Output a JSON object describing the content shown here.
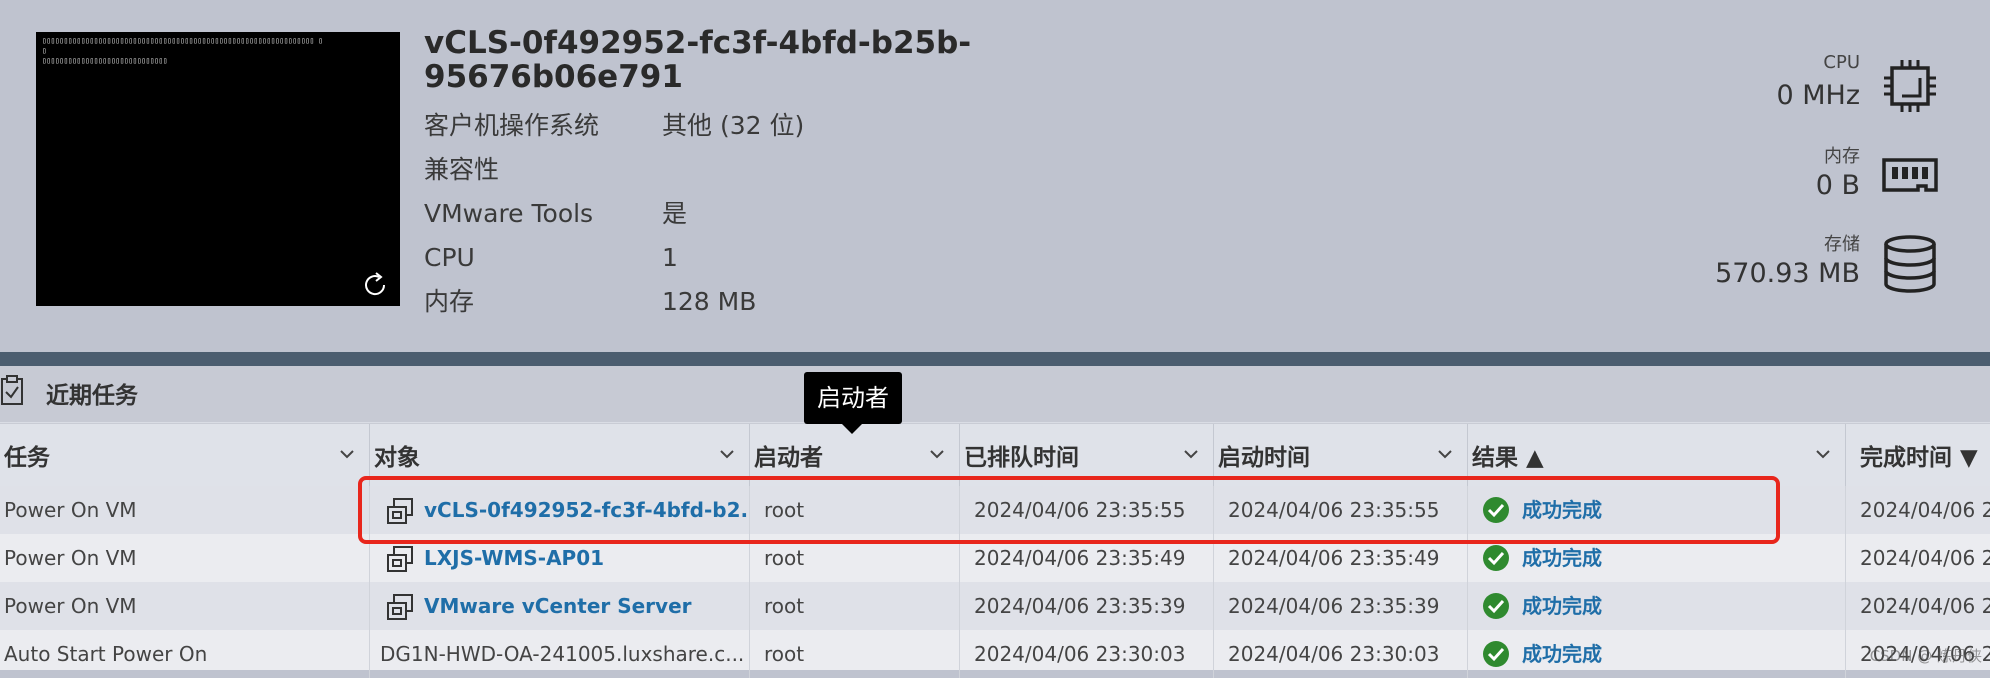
{
  "vm": {
    "title": "vCLS-0f492952-fc3f-4bfd-b25b-95676b06e791",
    "console_lines": [
      "▯▯▯▯▯▯▯▯▯▯▯▯▯▯▯▯▯▯▯▯▯▯▯▯▯▯▯▯▯▯▯▯▯▯▯▯▯▯▯▯▯▯▯▯▯▯▯▯▯▯▯▯▯▯▯▯▯▯▯▯▯▯▯ ▯",
      "▯",
      "▯▯▯▯▯▯▯▯▯▯▯▯▯▯▯▯▯▯▯▯▯▯▯▯▯▯▯▯▯"
    ],
    "properties": [
      {
        "label": "客户机操作系统",
        "value": "其他 (32 位)"
      },
      {
        "label": "兼容性",
        "value": ""
      },
      {
        "label": "VMware Tools",
        "value": "是"
      },
      {
        "label": "CPU",
        "value": "1"
      },
      {
        "label": "内存",
        "value": "128 MB"
      }
    ]
  },
  "resources": {
    "cpu": {
      "label": "CPU",
      "value": "0 MHz",
      "icon": "cpu-icon"
    },
    "memory": {
      "label": "内存",
      "value": "0 B",
      "icon": "memory-icon"
    },
    "storage": {
      "label": "存储",
      "value": "570.93 MB",
      "icon": "storage-icon"
    }
  },
  "recent_tasks": {
    "title": "近期任务",
    "tooltip": "启动者",
    "columns": [
      {
        "label": "任务"
      },
      {
        "label": "对象"
      },
      {
        "label": "启动者"
      },
      {
        "label": "已排队时间"
      },
      {
        "label": "启动时间"
      },
      {
        "label": "结果 ▲"
      },
      {
        "label": "完成时间 ▼"
      }
    ],
    "rows": [
      {
        "task": "Power On VM",
        "object": "vCLS-0f492952-fc3f-4bfd-b2...",
        "object_is_link": true,
        "initiator": "root",
        "queued": "2024/04/06 23:35:55",
        "started": "2024/04/06 23:35:55",
        "result": "成功完成",
        "completed": "2024/04/06 2"
      },
      {
        "task": "Power On VM",
        "object": "LXJS-WMS-AP01",
        "object_is_link": true,
        "initiator": "root",
        "queued": "2024/04/06 23:35:49",
        "started": "2024/04/06 23:35:49",
        "result": "成功完成",
        "completed": "2024/04/06 2"
      },
      {
        "task": "Power On VM",
        "object": "VMware vCenter Server",
        "object_is_link": true,
        "initiator": "root",
        "queued": "2024/04/06 23:35:39",
        "started": "2024/04/06 23:35:39",
        "result": "成功完成",
        "completed": "2024/04/06 2"
      },
      {
        "task": "Auto Start Power On",
        "object": "DG1N-HWD-OA-241005.luxshare.c...",
        "object_is_link": false,
        "initiator": "root",
        "queued": "2024/04/06 23:30:03",
        "started": "2024/04/06 23:30:03",
        "result": "成功完成",
        "completed": "2024/04/06 2"
      }
    ],
    "watermark": "CSDN @ 炼丹侠"
  },
  "colors": {
    "link": "#1f6ea8",
    "success": "#2f8a2f",
    "highlight": "#e8261c",
    "divider": "#4b5d6f"
  }
}
